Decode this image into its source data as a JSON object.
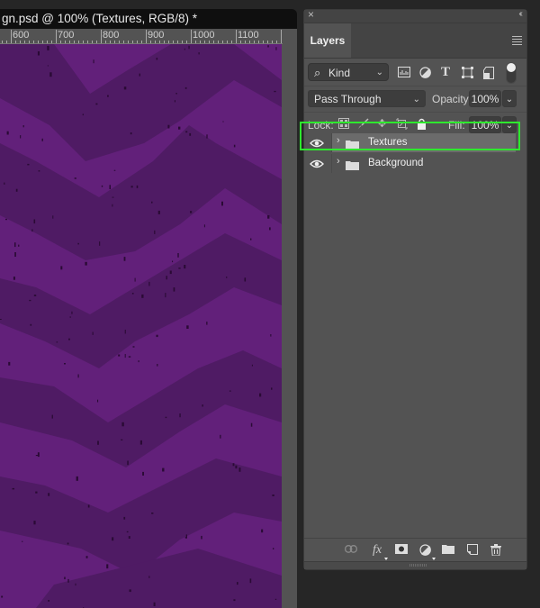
{
  "document": {
    "tab_title": "gn.psd @ 100% (Textures, RGB/8) *",
    "ruler_labels": [
      "600",
      "700",
      "800",
      "900",
      "1000",
      "1100"
    ],
    "canvas_color": "#62207a",
    "pattern_color": "#4e1a63"
  },
  "panel": {
    "close_glyph": "×",
    "collapse_glyph": "‹‹",
    "tab_label": "Layers",
    "filter": {
      "kind_label": "Kind",
      "icons": [
        "image-filter-icon",
        "adjustment-filter-icon",
        "type-filter-icon",
        "shape-filter-icon",
        "smart-object-filter-icon"
      ]
    },
    "blend_mode": "Pass Through",
    "opacity_label": "Opacity:",
    "opacity_value": "100%",
    "lock_label": "Lock:",
    "fill_label": "Fill:",
    "fill_value": "100%",
    "layers": [
      {
        "name": "Textures",
        "visible": true,
        "selected": true,
        "type": "group"
      },
      {
        "name": "Background",
        "visible": true,
        "selected": false,
        "type": "group"
      }
    ],
    "highlight_color": "#2ee82e"
  }
}
